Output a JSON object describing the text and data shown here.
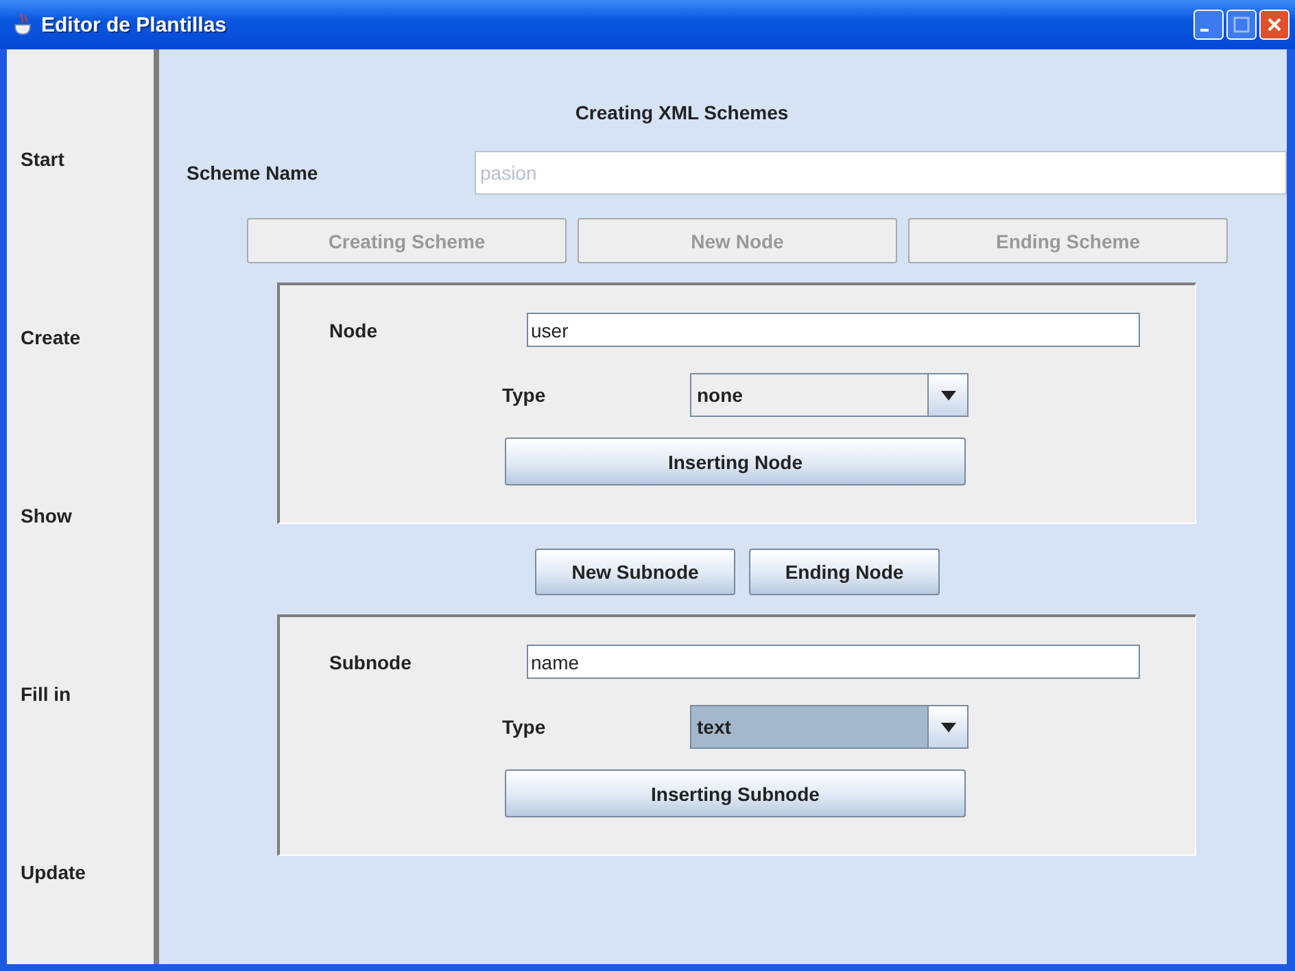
{
  "window": {
    "title": "Editor de Plantillas"
  },
  "sidebar": {
    "items": [
      {
        "label": "Start"
      },
      {
        "label": "Create"
      },
      {
        "label": "Show"
      },
      {
        "label": "Fill in"
      },
      {
        "label": "Update"
      }
    ]
  },
  "heading": "Creating XML Schemes",
  "scheme_name": {
    "label": "Scheme Name",
    "value": "pasion",
    "disabled": true
  },
  "scheme_buttons": [
    {
      "label": "Creating Scheme",
      "disabled": true
    },
    {
      "label": "New Node",
      "disabled": true
    },
    {
      "label": "Ending Scheme",
      "disabled": true
    }
  ],
  "node_panel": {
    "label": "Node",
    "value": "user",
    "type_label": "Type",
    "type_value": "none",
    "type_focused": false,
    "button": {
      "label": "Inserting Node",
      "disabled": false
    }
  },
  "node_buttons": [
    {
      "label": "New Subnode",
      "disabled": false
    },
    {
      "label": "Ending Node",
      "disabled": false
    }
  ],
  "subnode_panel": {
    "label": "Subnode",
    "value": "name",
    "type_label": "Type",
    "type_value": "text",
    "type_focused": true,
    "button": {
      "label": "Inserting Subnode",
      "disabled": false
    }
  }
}
